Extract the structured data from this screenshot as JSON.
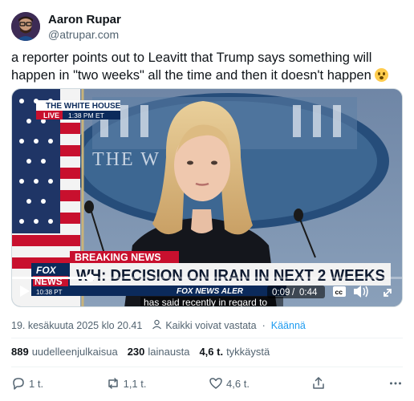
{
  "author": {
    "name": "Aaron Rupar",
    "handle": "@atrupar.com"
  },
  "tweet": {
    "text": "a reporter points out to Leavitt that Trump says something will happen in \"two weeks\" all the time and then it doesn't happen",
    "emoji": "flushed-face"
  },
  "video": {
    "bug_title": "THE WHITE HOUSE",
    "live_label": "LIVE",
    "bug_time": "1:38 PM ET",
    "backdrop_text": "THE W    OUSE",
    "breaking_label": "BREAKING NEWS",
    "headline": "WH: DECISION ON IRAN IN NEXT 2 WEEKS",
    "ticker": "FOX NEWS ALER",
    "logo_line1": "FOX",
    "logo_line2": "NEWS",
    "logo_time": "10:38 PT",
    "caption": "has said recently in regard to",
    "current_time": "0:09",
    "duration": "0:44",
    "progress": 0.2,
    "cc_label": "cc"
  },
  "meta": {
    "date": "19. kesäkuuta 2025 klo 20.41",
    "reply_setting": "Kaikki voivat vastata",
    "separator": "·",
    "translate": "Käännä"
  },
  "stats": {
    "reposts_count": "889",
    "reposts_label": "uudelleenjulkaisua",
    "quotes_count": "230",
    "quotes_label": "lainausta",
    "likes_count": "4,6 t.",
    "likes_label": "tykkäystä"
  },
  "actions": {
    "replies": "1 t.",
    "reposts": "1,1 t.",
    "likes": "4,6 t."
  },
  "colors": {
    "text": "#0f1419",
    "secondary": "#536471",
    "link": "#1d9bf0",
    "breaking_red": "#c8102e",
    "fox_navy": "#0b2a5b"
  }
}
